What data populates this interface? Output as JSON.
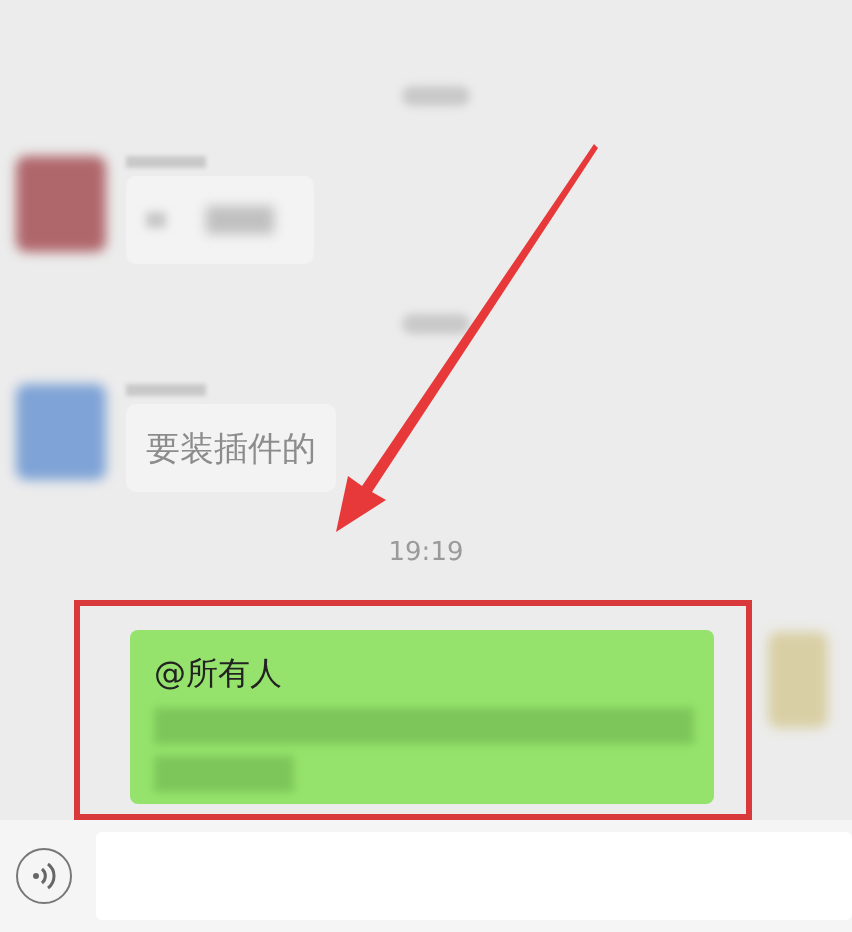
{
  "messages": [
    {
      "kind": "time_blurred"
    },
    {
      "kind": "incoming"
    },
    {
      "kind": "time_blurred"
    },
    {
      "kind": "incoming",
      "text": "要装插件的"
    },
    {
      "kind": "time",
      "text": "19:19"
    },
    {
      "kind": "outgoing",
      "highlighted": true,
      "text": "@所有人"
    }
  ]
}
